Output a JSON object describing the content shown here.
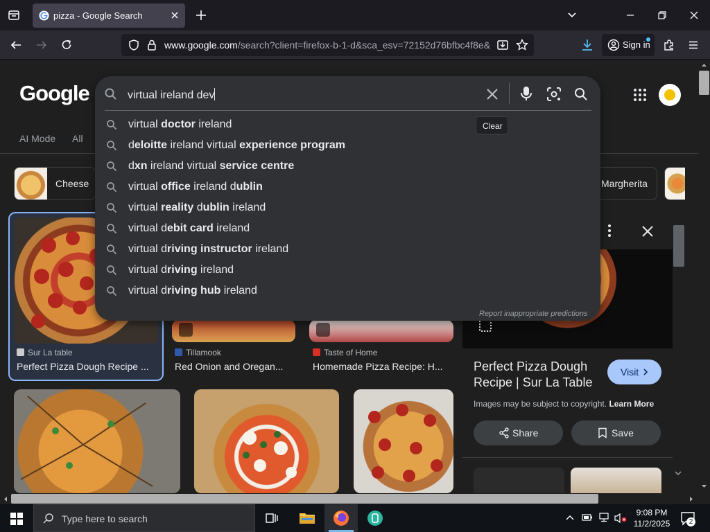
{
  "browser": {
    "tab_title": "pizza - Google Search",
    "url_host": "www.google.com",
    "url_rest": "/search?client=firefox-b-1-d&sca_esv=72152d76bfbc4f8e&",
    "signin_label": "Sign in"
  },
  "page": {
    "logo": "Google",
    "nav_tabs": [
      "AI Mode",
      "All"
    ],
    "chips": [
      {
        "label": "Cheese"
      },
      {
        "label": "Margherita"
      }
    ],
    "results": [
      {
        "source": "Sur La table",
        "title": "Perfect Pizza Dough Recipe ...",
        "icon_color": "#cccccc"
      },
      {
        "source": "Tillamook",
        "title": "Red Onion and Oregan...",
        "icon_color": "#2e5aac"
      },
      {
        "source": "Taste of Home",
        "title": "Homemade Pizza Recipe: H...",
        "icon_color": "#d93025"
      }
    ]
  },
  "panel": {
    "title": "Perfect Pizza Dough Recipe | Sur La Table",
    "visit_label": "Visit",
    "copyright": "Images may be subject to copyright.",
    "learn_more": "Learn More",
    "share_label": "Share",
    "save_label": "Save"
  },
  "search": {
    "query": "virtual ireland dev",
    "clear_tooltip": "Clear",
    "suggestions": [
      [
        {
          "t": "virtual "
        },
        {
          "t": "doctor",
          "b": true
        },
        {
          "t": " ireland"
        }
      ],
      [
        {
          "t": "d"
        },
        {
          "t": "eloitte",
          "b": true
        },
        {
          "t": " ireland virtual "
        },
        {
          "t": "experience program",
          "b": true
        }
      ],
      [
        {
          "t": "d"
        },
        {
          "t": "xn",
          "b": true
        },
        {
          "t": " ireland virtual "
        },
        {
          "t": "service centre",
          "b": true
        }
      ],
      [
        {
          "t": "virtual "
        },
        {
          "t": "office",
          "b": true
        },
        {
          "t": " ireland d"
        },
        {
          "t": "ublin",
          "b": true
        }
      ],
      [
        {
          "t": "virtual "
        },
        {
          "t": "reality",
          "b": true
        },
        {
          "t": " d"
        },
        {
          "t": "ublin",
          "b": true
        },
        {
          "t": " ireland"
        }
      ],
      [
        {
          "t": "virtual d"
        },
        {
          "t": "ebit card",
          "b": true
        },
        {
          "t": " ireland"
        }
      ],
      [
        {
          "t": "virtual d"
        },
        {
          "t": "riving instructor",
          "b": true
        },
        {
          "t": " ireland"
        }
      ],
      [
        {
          "t": "virtual d"
        },
        {
          "t": "riving",
          "b": true
        },
        {
          "t": " ireland"
        }
      ],
      [
        {
          "t": "virtual d"
        },
        {
          "t": "riving hub",
          "b": true
        },
        {
          "t": " ireland"
        }
      ]
    ],
    "report_label": "Report inappropriate predictions"
  },
  "taskbar": {
    "search_placeholder": "Type here to search",
    "time": "9:08 PM",
    "date": "11/2/2025",
    "notification_count": "2"
  },
  "icons": {
    "search": "search-icon",
    "mic": "mic-icon",
    "lens": "lens-icon",
    "clear": "close-icon"
  },
  "colors": {
    "background": "#1f1f1f",
    "search_surface": "#303134",
    "visit_button": "#a8c7fa",
    "browser_toolbar": "#2b2a33"
  }
}
